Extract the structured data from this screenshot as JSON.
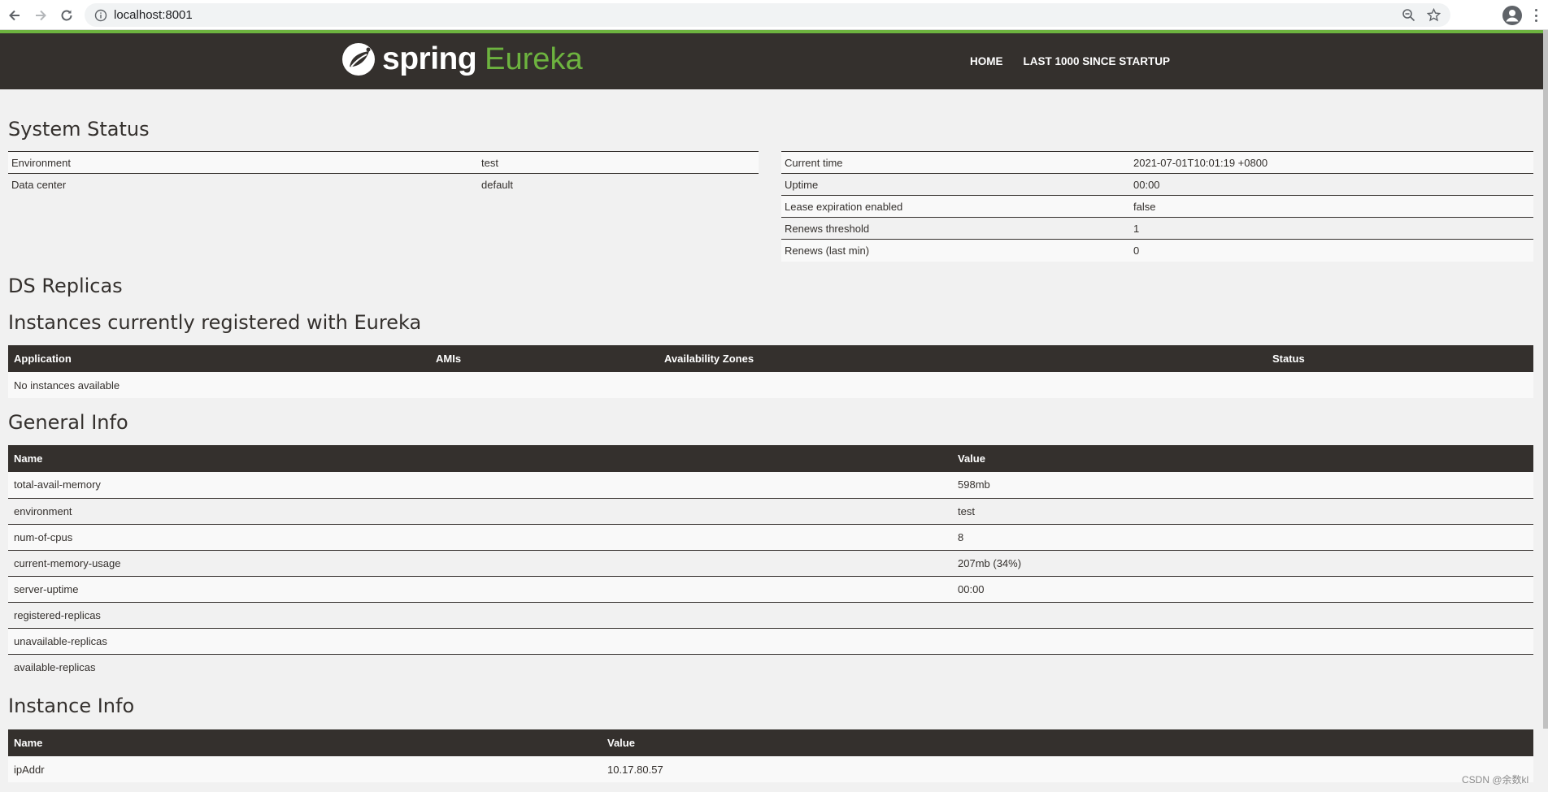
{
  "browser": {
    "url": "localhost:8001"
  },
  "navbar": {
    "brand_spring": "spring",
    "brand_eureka": "Eureka",
    "links": [
      "HOME",
      "LAST 1000 SINCE STARTUP"
    ]
  },
  "system_status": {
    "title": "System Status",
    "left": [
      {
        "label": "Environment",
        "value": "test"
      },
      {
        "label": "Data center",
        "value": "default"
      }
    ],
    "right": [
      {
        "label": "Current time",
        "value": "2021-07-01T10:01:19 +0800"
      },
      {
        "label": "Uptime",
        "value": "00:00"
      },
      {
        "label": "Lease expiration enabled",
        "value": "false"
      },
      {
        "label": "Renews threshold",
        "value": "1"
      },
      {
        "label": "Renews (last min)",
        "value": "0"
      }
    ]
  },
  "ds_replicas": {
    "title": "DS Replicas"
  },
  "instances": {
    "title": "Instances currently registered with Eureka",
    "columns": [
      "Application",
      "AMIs",
      "Availability Zones",
      "Status"
    ],
    "empty_text": "No instances available"
  },
  "general_info": {
    "title": "General Info",
    "columns": [
      "Name",
      "Value"
    ],
    "rows": [
      {
        "name": "total-avail-memory",
        "value": "598mb"
      },
      {
        "name": "environment",
        "value": "test"
      },
      {
        "name": "num-of-cpus",
        "value": "8"
      },
      {
        "name": "current-memory-usage",
        "value": "207mb (34%)"
      },
      {
        "name": "server-uptime",
        "value": "00:00"
      },
      {
        "name": "registered-replicas",
        "value": ""
      },
      {
        "name": "unavailable-replicas",
        "value": ""
      },
      {
        "name": "available-replicas",
        "value": ""
      }
    ]
  },
  "instance_info": {
    "title": "Instance Info",
    "columns": [
      "Name",
      "Value"
    ],
    "rows": [
      {
        "name": "ipAddr",
        "value": "10.17.80.57"
      }
    ]
  },
  "watermark": "CSDN @余数kl",
  "colors": {
    "navbar_bg": "#34302d",
    "accent_green": "#6db33f",
    "page_bg": "#f1f1f1"
  },
  "icons": [
    "back-arrow-icon",
    "forward-arrow-icon",
    "reload-icon",
    "info-icon",
    "zoom-icon",
    "star-icon",
    "profile-icon",
    "menu-kebab-icon",
    "spring-leaf-icon"
  ]
}
